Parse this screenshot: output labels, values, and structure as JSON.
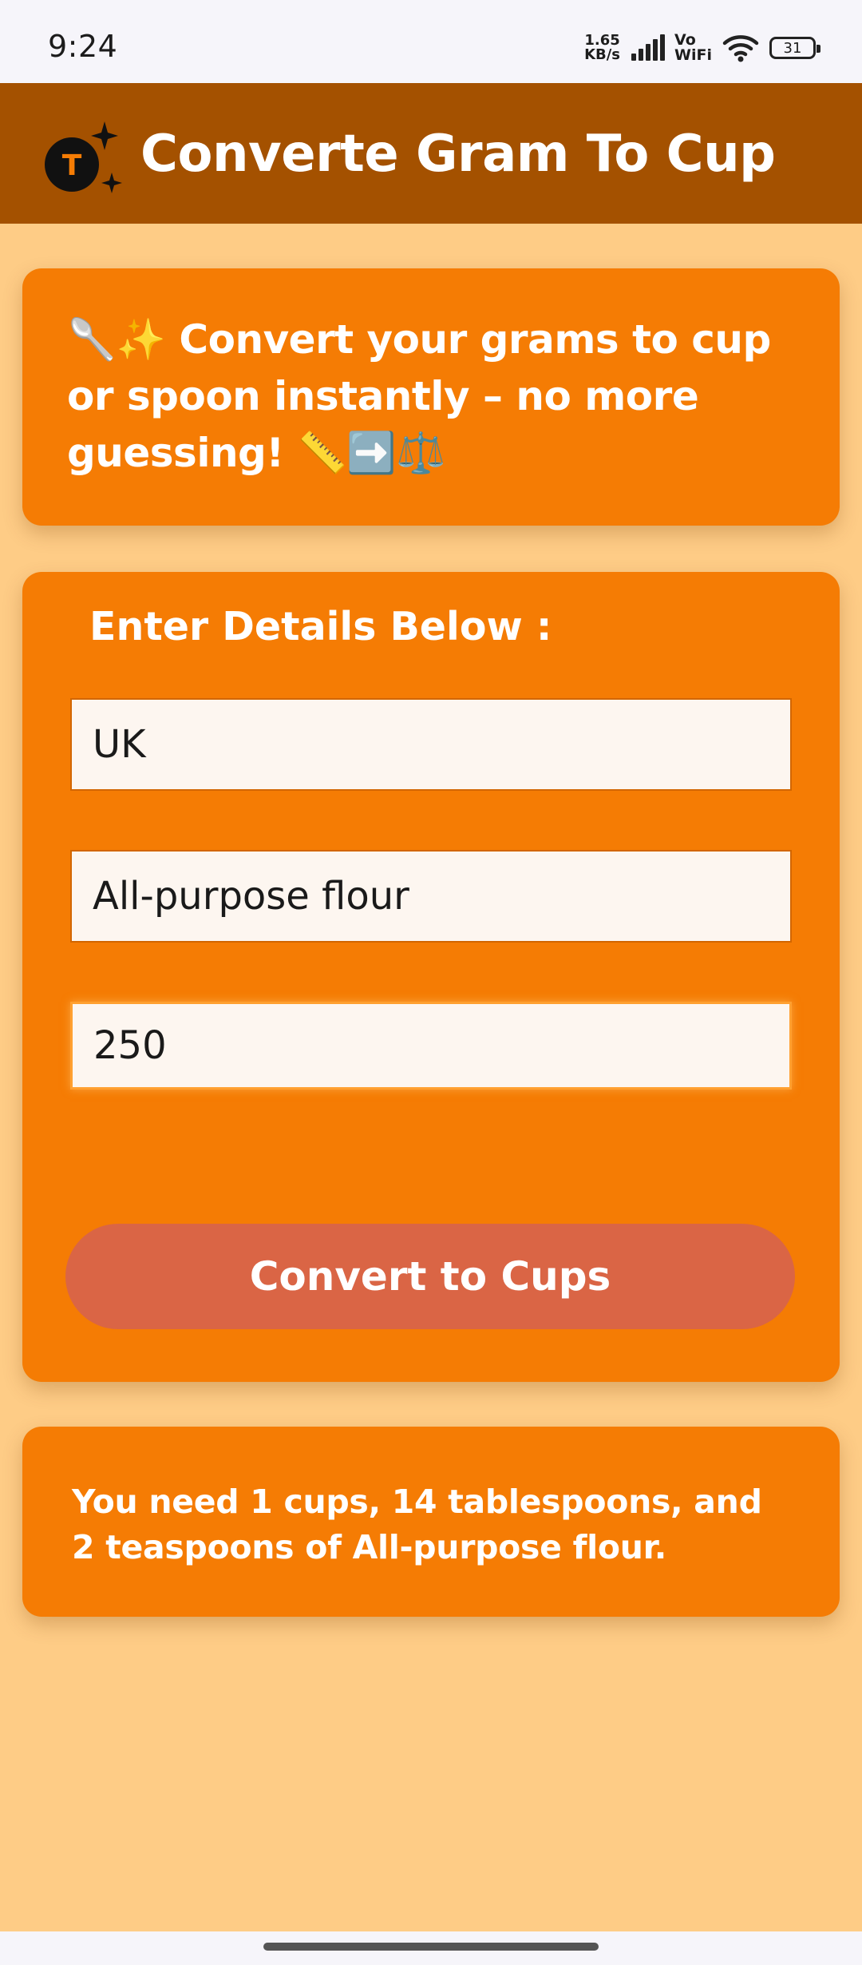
{
  "status_bar": {
    "time": "9:24",
    "net_speed_value": "1.65",
    "net_speed_unit": "KB/s",
    "vo_label": "Vo",
    "wifi_label": "WiFi",
    "battery": "31",
    "icons": [
      "signal-icon",
      "wifi-icon",
      "battery-icon"
    ]
  },
  "app_bar": {
    "logo_letter": "T",
    "title": "Converte Gram To Cup",
    "background_color": "#A45100"
  },
  "intro": {
    "emoji_lead": "🥄✨",
    "text": " Convert your grams to cup or spoon instantly – no more guessing! ",
    "emoji_trail": "📏➡️⚖️"
  },
  "form": {
    "heading": "Enter Details Below :",
    "country_value": "UK",
    "ingredient_value": "All-purpose flour",
    "grams_value": "250",
    "convert_label": "Convert to Cups"
  },
  "result": {
    "text": "You need 1 cups, 14 tablespoons, and 2 teaspoons of All-purpose flour."
  },
  "colors": {
    "page_background": "#FECC86",
    "card": "#F57C04",
    "button": "#DA6545",
    "field": "#FDF6F0"
  }
}
